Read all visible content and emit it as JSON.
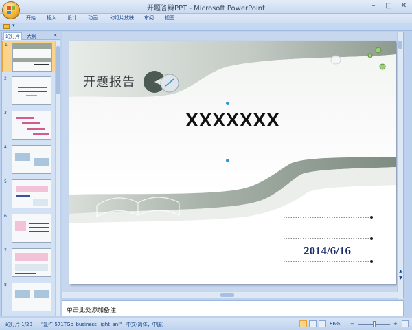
{
  "window": {
    "title": "开题答辩PPT - Microsoft PowerPoint",
    "minimize": "–",
    "maximize": "□",
    "close": "✕"
  },
  "ribbon": {
    "tabs": [
      "开始",
      "插入",
      "设计",
      "动画",
      "幻灯片放映",
      "审阅",
      "视图"
    ]
  },
  "qat": {
    "folder_icon": "folder-icon",
    "customize_arrow": "▾"
  },
  "left_pane": {
    "tabs": [
      "幻灯片",
      "大纲"
    ],
    "close": "✕",
    "slide_numbers": [
      "1",
      "2",
      "3",
      "4",
      "5",
      "6",
      "7",
      "8"
    ],
    "selected_index": 0
  },
  "slide": {
    "title": "开题报告",
    "main_text": "XXXXXXX",
    "date": "2014/6/16",
    "colors": {
      "band": "#8c9a8e",
      "band_light": "#c9d1ca",
      "text_dark": "#1b2d6b"
    }
  },
  "scroll": {
    "prev_slide": "▲",
    "next_slide": "▼"
  },
  "notes": {
    "placeholder": "单击此处添加备注"
  },
  "status_bar": {
    "slide_info": "幻灯片 1/20",
    "theme": "\"复件 571TGp_business_light_ani\"",
    "language": "中文(简体，中国)",
    "zoom": "86%",
    "zoom_minus": "−",
    "zoom_plus": "+"
  }
}
